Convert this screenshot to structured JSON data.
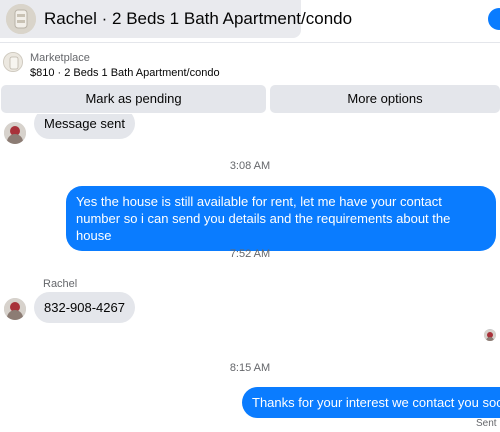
{
  "conversation": {
    "title": "Rachel · 2 Beds 1 Bath Apartment/condo"
  },
  "listing": {
    "source": "Marketplace",
    "summary": "$810 · 2 Beds 1 Bath Apartment/condo"
  },
  "actions": {
    "mark_pending_label": "Mark as pending",
    "more_options_label": "More options"
  },
  "messages": {
    "incoming_partial": "Message sent",
    "time_1": "3:08 AM",
    "outgoing_1": "Yes the house is still available for rent, let me have your contact number so i can send you details and the requirements about the house",
    "time_2": "7:52 AM",
    "sender_name": "Rachel",
    "incoming_phone": "832-908-4267",
    "time_3": "8:15 AM",
    "outgoing_2": "Thanks for your interest we contact you soon.",
    "status": "Sent"
  },
  "colors": {
    "outgoing_bubble": "#0a7cff",
    "incoming_bubble": "#e4e6eb",
    "title_pill": "#e9eaee"
  }
}
